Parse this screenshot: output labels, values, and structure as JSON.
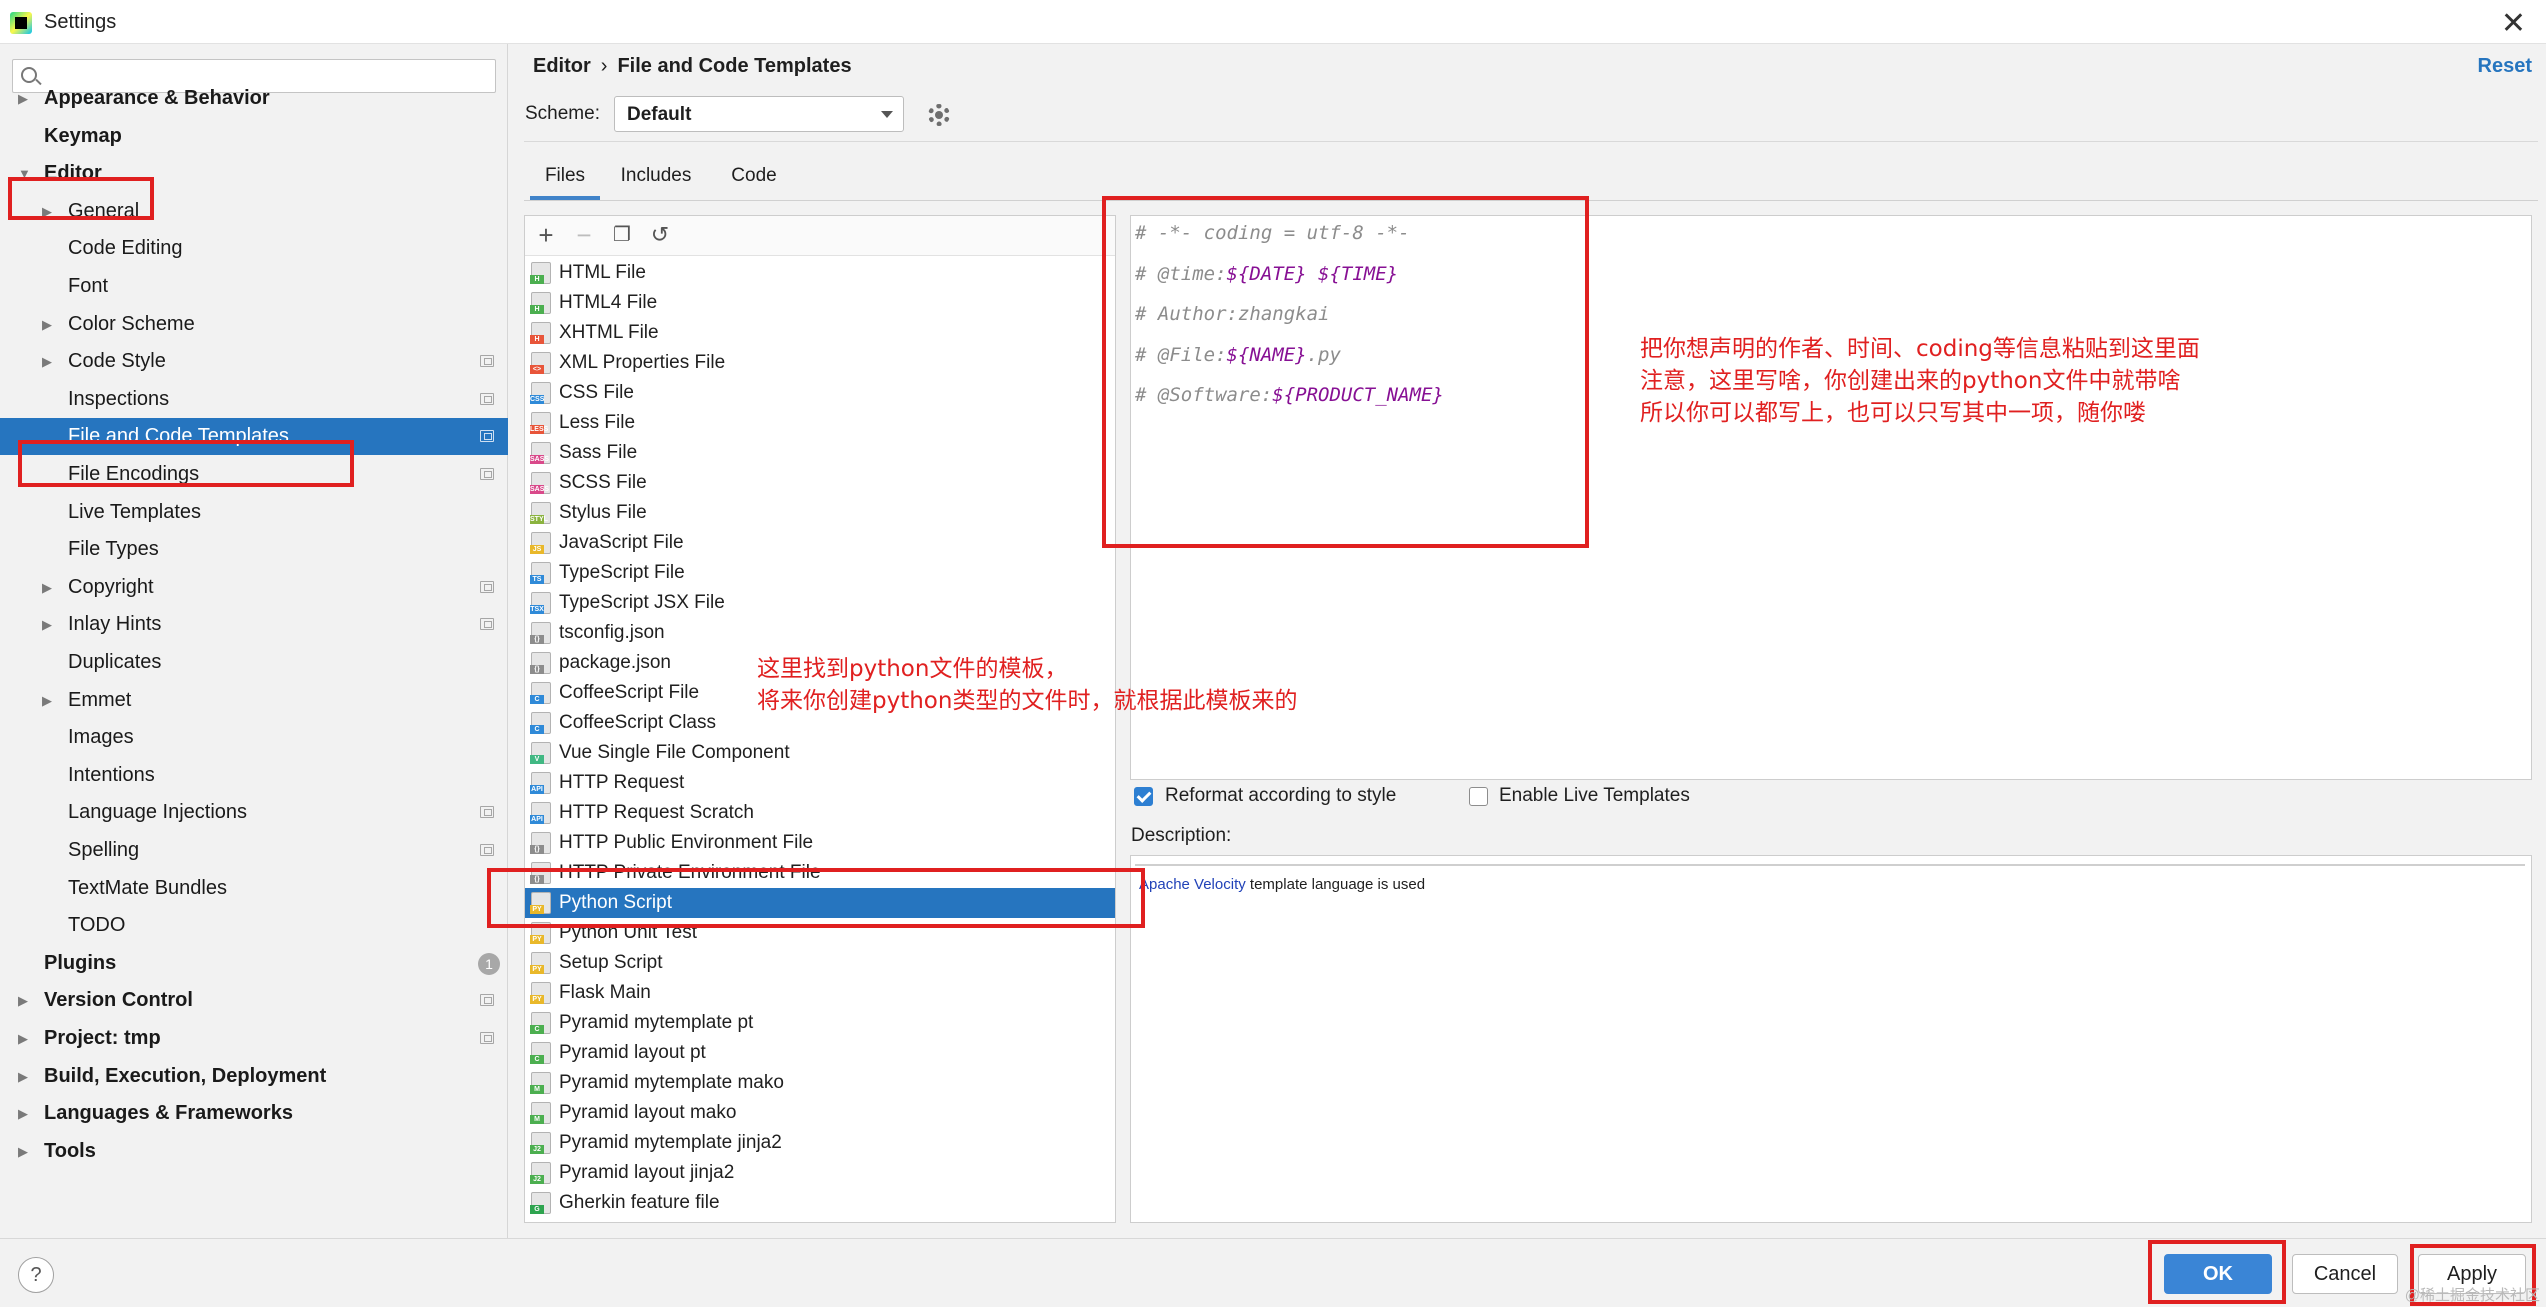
{
  "window": {
    "title": "Settings"
  },
  "sidebar": {
    "search_placeholder": "",
    "items": [
      {
        "label": "Appearance & Behavior",
        "bold": true,
        "arrow": "▶",
        "indent": 0,
        "proj": false
      },
      {
        "label": "Keymap",
        "bold": true,
        "arrow": "",
        "indent": 0,
        "proj": false
      },
      {
        "label": "Editor",
        "bold": true,
        "arrow": "▼",
        "indent": 0,
        "proj": false
      },
      {
        "label": "General",
        "bold": false,
        "arrow": "▶",
        "indent": 1,
        "proj": false
      },
      {
        "label": "Code Editing",
        "bold": false,
        "arrow": "",
        "indent": 1,
        "proj": false
      },
      {
        "label": "Font",
        "bold": false,
        "arrow": "",
        "indent": 1,
        "proj": false
      },
      {
        "label": "Color Scheme",
        "bold": false,
        "arrow": "▶",
        "indent": 1,
        "proj": false
      },
      {
        "label": "Code Style",
        "bold": false,
        "arrow": "▶",
        "indent": 1,
        "proj": true
      },
      {
        "label": "Inspections",
        "bold": false,
        "arrow": "",
        "indent": 1,
        "proj": true
      },
      {
        "label": "File and Code Templates",
        "bold": false,
        "arrow": "",
        "indent": 1,
        "proj": true,
        "selected": true
      },
      {
        "label": "File Encodings",
        "bold": false,
        "arrow": "",
        "indent": 1,
        "proj": true
      },
      {
        "label": "Live Templates",
        "bold": false,
        "arrow": "",
        "indent": 1,
        "proj": false
      },
      {
        "label": "File Types",
        "bold": false,
        "arrow": "",
        "indent": 1,
        "proj": false
      },
      {
        "label": "Copyright",
        "bold": false,
        "arrow": "▶",
        "indent": 1,
        "proj": true
      },
      {
        "label": "Inlay Hints",
        "bold": false,
        "arrow": "▶",
        "indent": 1,
        "proj": true
      },
      {
        "label": "Duplicates",
        "bold": false,
        "arrow": "",
        "indent": 1,
        "proj": false
      },
      {
        "label": "Emmet",
        "bold": false,
        "arrow": "▶",
        "indent": 1,
        "proj": false
      },
      {
        "label": "Images",
        "bold": false,
        "arrow": "",
        "indent": 1,
        "proj": false
      },
      {
        "label": "Intentions",
        "bold": false,
        "arrow": "",
        "indent": 1,
        "proj": false
      },
      {
        "label": "Language Injections",
        "bold": false,
        "arrow": "",
        "indent": 1,
        "proj": true
      },
      {
        "label": "Spelling",
        "bold": false,
        "arrow": "",
        "indent": 1,
        "proj": true
      },
      {
        "label": "TextMate Bundles",
        "bold": false,
        "arrow": "",
        "indent": 1,
        "proj": false
      },
      {
        "label": "TODO",
        "bold": false,
        "arrow": "",
        "indent": 1,
        "proj": false
      },
      {
        "label": "Plugins",
        "bold": true,
        "arrow": "",
        "indent": 0,
        "proj": false,
        "badge": "1"
      },
      {
        "label": "Version Control",
        "bold": true,
        "arrow": "▶",
        "indent": 0,
        "proj": true
      },
      {
        "label": "Project: tmp",
        "bold": true,
        "arrow": "▶",
        "indent": 0,
        "proj": true
      },
      {
        "label": "Build, Execution, Deployment",
        "bold": true,
        "arrow": "▶",
        "indent": 0,
        "proj": false
      },
      {
        "label": "Languages & Frameworks",
        "bold": true,
        "arrow": "▶",
        "indent": 0,
        "proj": false
      },
      {
        "label": "Tools",
        "bold": true,
        "arrow": "▶",
        "indent": 0,
        "proj": false
      }
    ]
  },
  "header": {
    "breadcrumb_parent": "Editor",
    "breadcrumb_sep": "›",
    "breadcrumb_current": "File and Code Templates",
    "reset_label": "Reset"
  },
  "scheme": {
    "label": "Scheme:",
    "value": "Default"
  },
  "tabs": [
    {
      "label": "Files",
      "active": true
    },
    {
      "label": "Includes",
      "active": false
    },
    {
      "label": "Code",
      "active": false
    }
  ],
  "toolbar_icons": [
    "add-icon",
    "remove-icon",
    "copy-icon",
    "reset-icon"
  ],
  "templates": [
    {
      "label": "HTML File",
      "icon": "H",
      "color": "#4caf50"
    },
    {
      "label": "HTML4 File",
      "icon": "H",
      "color": "#4caf50"
    },
    {
      "label": "XHTML File",
      "icon": "H",
      "color": "#e8553a"
    },
    {
      "label": "XML Properties File",
      "icon": "<>",
      "color": "#e8553a"
    },
    {
      "label": "CSS File",
      "icon": "CSS",
      "color": "#2f8ad8"
    },
    {
      "label": "Less File",
      "icon": "LESS",
      "color": "#e8553a"
    },
    {
      "label": "Sass File",
      "icon": "SASS",
      "color": "#d9498a"
    },
    {
      "label": "SCSS File",
      "icon": "SASS",
      "color": "#d9498a"
    },
    {
      "label": "Stylus File",
      "icon": "STYL",
      "color": "#8bb33f"
    },
    {
      "label": "JavaScript File",
      "icon": "JS",
      "color": "#e9b82a"
    },
    {
      "label": "TypeScript File",
      "icon": "TS",
      "color": "#2f8ad8"
    },
    {
      "label": "TypeScript JSX File",
      "icon": "TSX",
      "color": "#2f8ad8"
    },
    {
      "label": "tsconfig.json",
      "icon": "{}",
      "color": "#8d8d8d"
    },
    {
      "label": "package.json",
      "icon": "{}",
      "color": "#8d8d8d"
    },
    {
      "label": "CoffeeScript File",
      "icon": "C",
      "color": "#2f8ad8"
    },
    {
      "label": "CoffeeScript Class",
      "icon": "C",
      "color": "#2f8ad8"
    },
    {
      "label": "Vue Single File Component",
      "icon": "V",
      "color": "#41b883"
    },
    {
      "label": "HTTP Request",
      "icon": "API",
      "color": "#2f8ad8"
    },
    {
      "label": "HTTP Request Scratch",
      "icon": "API",
      "color": "#2f8ad8"
    },
    {
      "label": "HTTP Public Environment File",
      "icon": "{}",
      "color": "#8d8d8d"
    },
    {
      "label": "HTTP Private Environment File",
      "icon": "{}",
      "color": "#8d8d8d"
    },
    {
      "label": "Python Script",
      "icon": "PY",
      "color": "#e9b82a",
      "selected": true
    },
    {
      "label": "Python Unit Test",
      "icon": "PY",
      "color": "#e9b82a"
    },
    {
      "label": "Setup Script",
      "icon": "PY",
      "color": "#e9b82a"
    },
    {
      "label": "Flask Main",
      "icon": "PY",
      "color": "#e9b82a"
    },
    {
      "label": "Pyramid mytemplate pt",
      "icon": "C",
      "color": "#4caf50"
    },
    {
      "label": "Pyramid layout pt",
      "icon": "C",
      "color": "#4caf50"
    },
    {
      "label": "Pyramid mytemplate mako",
      "icon": "M",
      "color": "#4caf50"
    },
    {
      "label": "Pyramid layout mako",
      "icon": "M",
      "color": "#4caf50"
    },
    {
      "label": "Pyramid mytemplate jinja2",
      "icon": "J2",
      "color": "#4caf50"
    },
    {
      "label": "Pyramid layout jinja2",
      "icon": "J2",
      "color": "#4caf50"
    },
    {
      "label": "Gherkin feature file",
      "icon": "G",
      "color": "#2ea44f"
    }
  ],
  "editor": {
    "lines": [
      [
        {
          "t": "# -*- coding = utf-8 -*-",
          "v": false
        }
      ],
      [
        {
          "t": "# @time:",
          "v": false
        },
        {
          "t": "${DATE}",
          "v": true
        },
        {
          "t": " ",
          "v": false
        },
        {
          "t": "${TIME}",
          "v": true
        }
      ],
      [
        {
          "t": "# Author:zhangkai",
          "v": false
        }
      ],
      [
        {
          "t": "# @File:",
          "v": false
        },
        {
          "t": "${NAME}",
          "v": true
        },
        {
          "t": ".py",
          "v": false
        }
      ],
      [
        {
          "t": "# @Software:",
          "v": false
        },
        {
          "t": "${PRODUCT_NAME}",
          "v": true
        }
      ]
    ]
  },
  "options": {
    "reformat_label": "Reformat according to style",
    "reformat_checked": true,
    "live_label": "Enable Live Templates",
    "live_checked": false
  },
  "description": {
    "label": "Description:",
    "link": "Apache Velocity",
    "text": " template language is used"
  },
  "buttons": {
    "help": "?",
    "ok": "OK",
    "cancel": "Cancel",
    "apply": "Apply"
  },
  "annotations": {
    "note_editor": [
      "把你想声明的作者、时间、coding等信息粘贴到这里面",
      "注意，这里写啥，你创建出来的python文件中就带啥",
      "所以你可以都写上，也可以只写其中一项，随你喽"
    ],
    "note_list": [
      "这里找到python文件的模板，",
      "将来你创建python类型的文件时，就根据此模板来的"
    ]
  },
  "watermark": "@稀土掘金技术社区",
  "colors": {
    "accent": "#2675bf",
    "annotation": "#e02020",
    "template_var": "#871094",
    "comment": "#8c8c8c"
  }
}
